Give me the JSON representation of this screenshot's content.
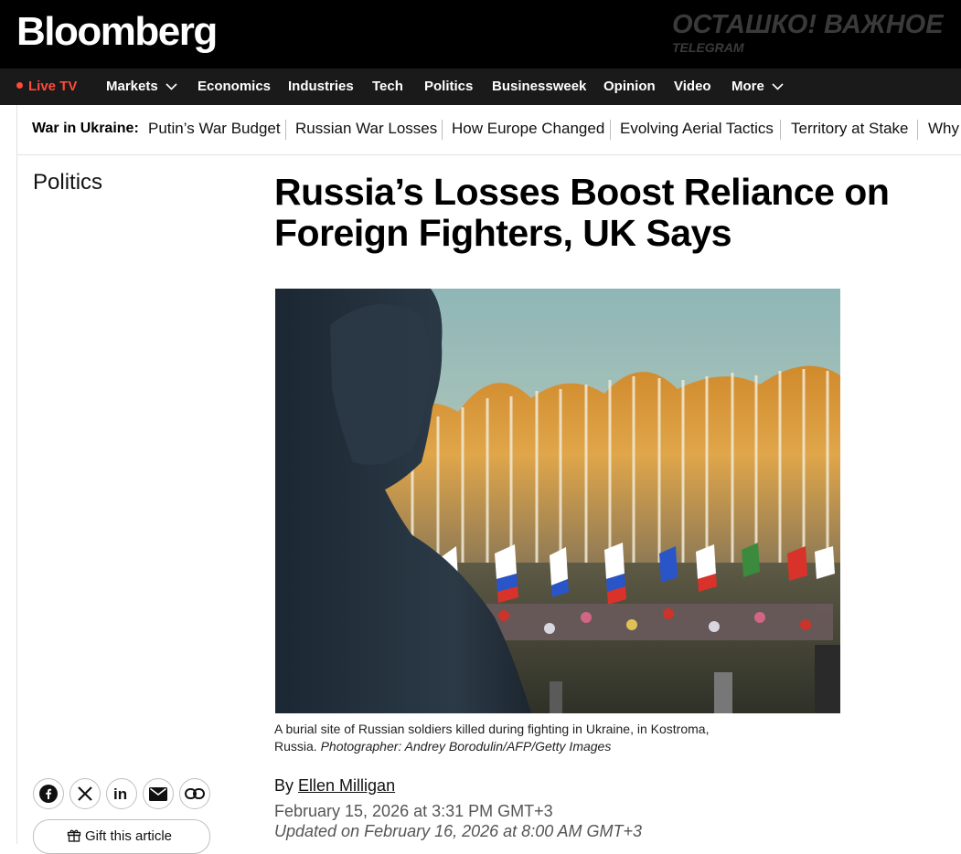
{
  "header": {
    "logo": "Bloomberg",
    "watermark_title": "ОСТАШКО! ВАЖНОЕ",
    "watermark_sub": "TELEGRAM"
  },
  "nav": {
    "live": "Live TV",
    "items": [
      "Markets",
      "Economics",
      "Industries",
      "Tech",
      "Politics",
      "Businessweek",
      "Opinion",
      "Video",
      "More"
    ]
  },
  "topics": {
    "label": "War in Ukraine:",
    "items": [
      "Putin’s War Budget",
      "Russian War Losses",
      "How Europe Changed",
      "Evolving Aerial Tactics",
      "Territory at Stake",
      "Why"
    ]
  },
  "article": {
    "section": "Politics",
    "headline": "Russia’s Losses Boost Reliance on Foreign Fighters, UK Says",
    "caption_text": "A burial site of Russian soldiers killed during fighting in Ukraine, in Kostroma, Russia.",
    "caption_credit": "Photographer: Andrey Borodulin/AFP/Getty Images",
    "byline_prefix": "By",
    "author": "Ellen Milligan",
    "published": "February 15, 2026 at 3:31 PM GMT+3",
    "updated": "Updated on February 16, 2026 at 8:00 AM GMT+3"
  },
  "share": {
    "icons": [
      "facebook-icon",
      "x-icon",
      "linkedin-icon",
      "email-icon",
      "link-icon"
    ],
    "gift_label": "Gift this article"
  },
  "colors": {
    "live_red": "#ff4a3a",
    "header_bg": "#000000",
    "nav_bg": "#1a1a1a"
  }
}
